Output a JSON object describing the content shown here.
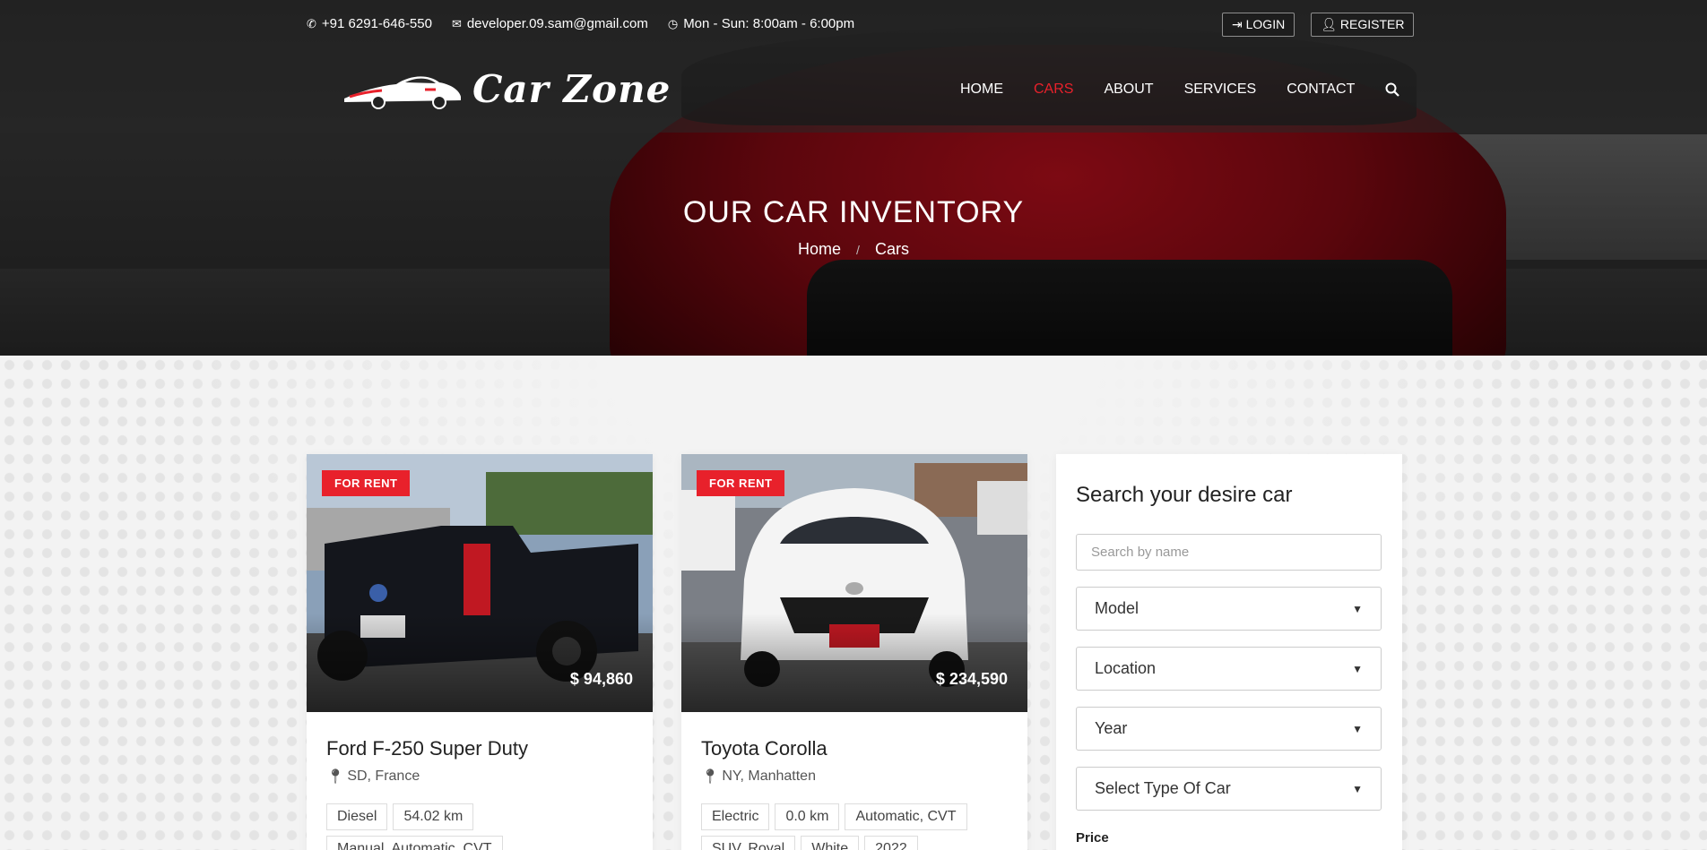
{
  "topbar": {
    "phone": "+91 6291-646-550",
    "email": "developer.09.sam@gmail.com",
    "hours": "Mon - Sun: 8:00am - 6:00pm",
    "login": "LOGIN",
    "register": "REGISTER"
  },
  "brand": {
    "name": "Car Zone"
  },
  "nav": {
    "home": "HOME",
    "cars": "CARS",
    "about": "ABOUT",
    "services": "SERVICES",
    "contact": "CONTACT",
    "active": "CARS"
  },
  "hero": {
    "title": "OUR CAR INVENTORY",
    "breadcrumb_home": "Home",
    "breadcrumb_sep": "/",
    "breadcrumb_current": "Cars"
  },
  "cars": [
    {
      "badge": "FOR RENT",
      "price": "$ 94,860",
      "name": "Ford F-250 Super Duty",
      "location": "SD, France",
      "tags": [
        "Diesel",
        "54.02 km",
        "Manual, Automatic, CVT"
      ]
    },
    {
      "badge": "FOR RENT",
      "price": "$ 234,590",
      "name": "Toyota Corolla",
      "location": "NY, Manhatten",
      "tags": [
        "Electric",
        "0.0 km",
        "Automatic, CVT",
        "SUV, Royal",
        "White",
        "2022"
      ]
    }
  ],
  "search": {
    "title": "Search your desire car",
    "name_placeholder": "Search by name",
    "model": "Model",
    "location": "Location",
    "year": "Year",
    "type": "Select Type Of Car",
    "price_label": "Price"
  },
  "colors": {
    "accent": "#e8212b",
    "hero_red": "#c0101e"
  }
}
